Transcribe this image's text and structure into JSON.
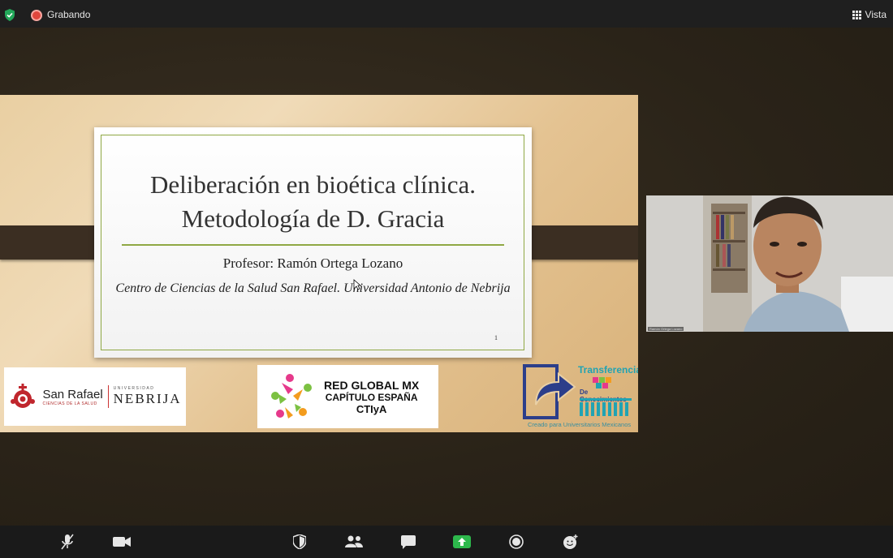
{
  "topbar": {
    "recording_label": "Grabando",
    "view_label": "Vista"
  },
  "slide": {
    "title_line1": "Deliberación en bioética clínica.",
    "title_line2": "Metodología de D. Gracia",
    "professor": "Profesor: Ramón Ortega Lozano",
    "institution": "Centro de Ciencias de la Salud San Rafael. Universidad Antonio de Nebrija",
    "page_number": "1",
    "logos": {
      "san_rafael": {
        "name": "San Rafael",
        "subtitle": "CIENCIAS DE LA SALUD",
        "university_label": "UNIVERSIDAD",
        "university_name": "NEBRIJA"
      },
      "red_global": {
        "line1": "RED GLOBAL MX",
        "line2": "CAPÍTULO ESPAÑA",
        "line3": "CTIyA"
      },
      "transferencia": {
        "title": "Transferencia",
        "subtitle": "De Conocimientos",
        "footer": "Creado para Universitarios Mexicanos"
      }
    }
  },
  "participant": {
    "name": "Ramón Ortega Lozano"
  },
  "toolbar": {
    "items": [
      "mic-muted-icon",
      "camera-icon",
      "security-icon",
      "participants-icon",
      "chat-icon",
      "share-screen-icon",
      "record-icon",
      "reactions-icon"
    ],
    "share_color": "#2db84c"
  },
  "colors": {
    "accent_green": "#8fa844",
    "record_red": "#e0463d",
    "shield_green": "#23a85a"
  }
}
